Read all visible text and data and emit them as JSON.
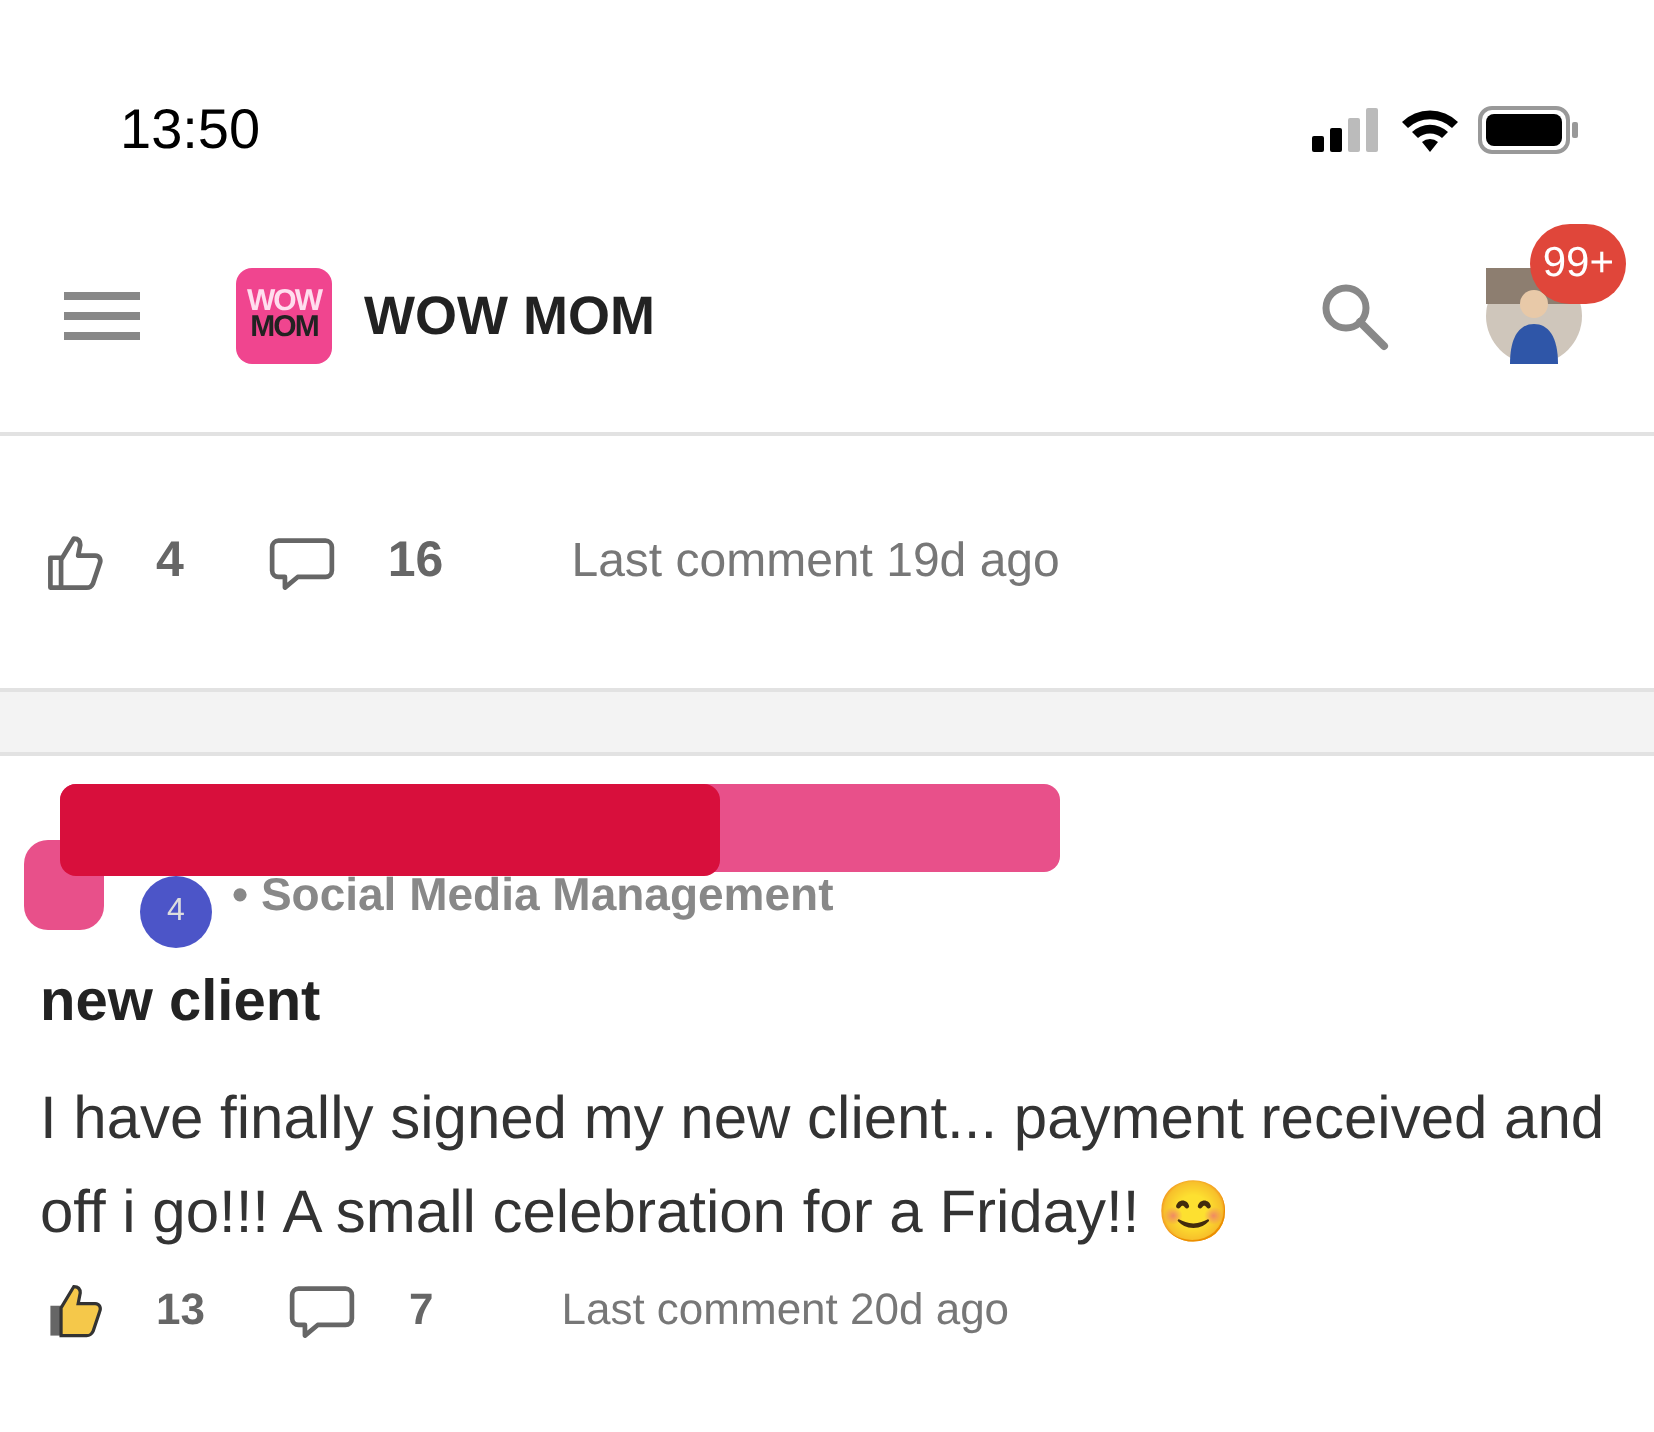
{
  "status_bar": {
    "time": "13:50"
  },
  "header": {
    "logo_text": [
      "WOW",
      "MOM"
    ],
    "title": "WOW MOM",
    "notification_count": "99+"
  },
  "posts": [
    {
      "likes": "4",
      "comments": "16",
      "last_comment": "Last comment 19d ago",
      "liked": false
    },
    {
      "author_badge": "4",
      "category": "• Social Media Management",
      "redacted": true,
      "title": "new client",
      "body": "I have finally signed my new client... payment received and off i go!!! A small celebration for a Friday!! 😊",
      "likes": "13",
      "comments": "7",
      "last_comment": "Last comment 20d ago",
      "liked": true
    }
  ]
}
